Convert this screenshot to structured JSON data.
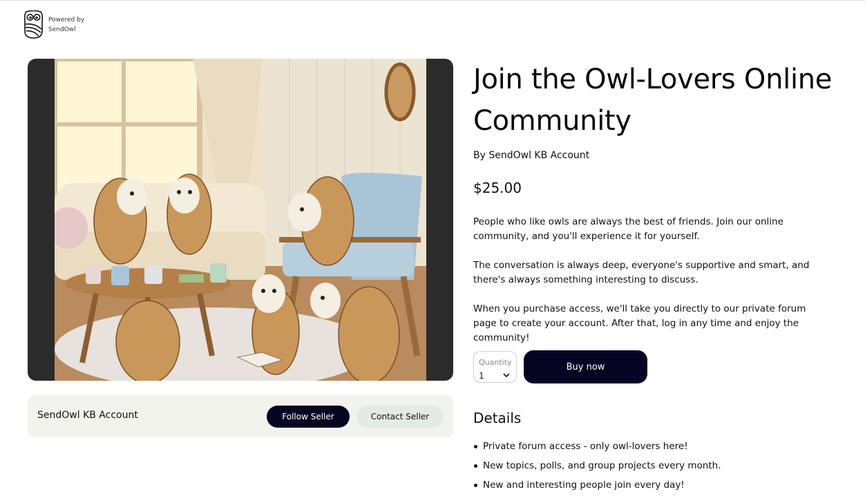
{
  "brand": {
    "line1": "Powered by",
    "line2": "SendOwl"
  },
  "product": {
    "title": "Join the Owl-Lovers Online Community",
    "byline": "By SendOwl KB Account",
    "price": "$25.00",
    "description": [
      "People who like owls are always the best of friends. Join our online community, and you'll experience it for yourself.",
      "The conversation is always deep, everyone's supportive and smart, and there's always something interesting to discuss.",
      "When you purchase access, we'll take you directly to our private forum page to create your account. After that, log in any time and enjoy the community!"
    ]
  },
  "purchase": {
    "quantity_label": "Quantity",
    "quantity_value": "1",
    "buy_label": "Buy now"
  },
  "seller": {
    "name": "SendOwl KB Account",
    "follow_label": "Follow Seller",
    "contact_label": "Contact Seller"
  },
  "details": {
    "title": "Details",
    "items": [
      "Private forum access - only owl-lovers here!",
      "New topics, polls, and group projects every month.",
      "New and interesting people join every day!"
    ]
  },
  "colors": {
    "primary_button": "#050523",
    "seller_bar": "#f3f3ee",
    "contact_button": "#e4ebe4",
    "media_frame": "#2b2b2b"
  }
}
